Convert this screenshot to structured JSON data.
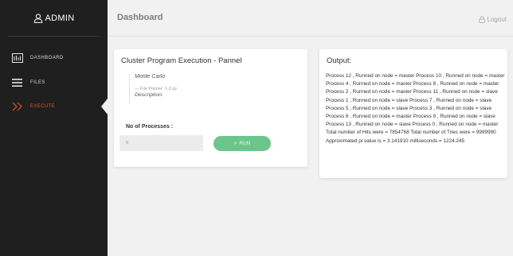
{
  "sidebar": {
    "brand": "ADMIN",
    "items": [
      {
        "label": "DASHBOARD",
        "icon": "dashboard-icon"
      },
      {
        "label": "FILES",
        "icon": "hamburger-icon"
      },
      {
        "label": "EXECUTE",
        "icon": "double-chevron-icon"
      }
    ],
    "active_color": "#e7561f"
  },
  "header": {
    "title": "Dashboard",
    "logout_label": "Logout"
  },
  "execution": {
    "title": "Cluster Program Execution - Pannel",
    "program_name": "Monte Carlo",
    "file_pointer": "— File Pointer: 1-2.py",
    "description_label": "Description:",
    "processes_label": "No of Processes :",
    "processes_value": "6",
    "run_label": "RUN"
  },
  "output": {
    "title": "Output:",
    "text": "Process 12 , Runned on node = master Process 10 , Runned on node = master Process 4 , Runned on node = master Process 8 , Runned on node = master Process 2 , Runned on node = master Process 11 , Runned on node = slave Process 1 , Runned on node = slave Process 7 , Runned on node = slave Process 5 , Runned on node = slave Process 3 , Runned on node = slave Process 6 , Runned on node = master Process 9 , Runned on node = slave Process 13 , Runned on node = slave Process 0 , Runned on node = master Total number of Hits were = 7854768 Total number of Tries were = 9999990 Approximated pi value is = 3.141910 milliseconds = 1224.245"
  },
  "colors": {
    "sidebar_bg": "#1f1f1f",
    "run_button": "#6cc58a",
    "active": "#e7561f"
  }
}
